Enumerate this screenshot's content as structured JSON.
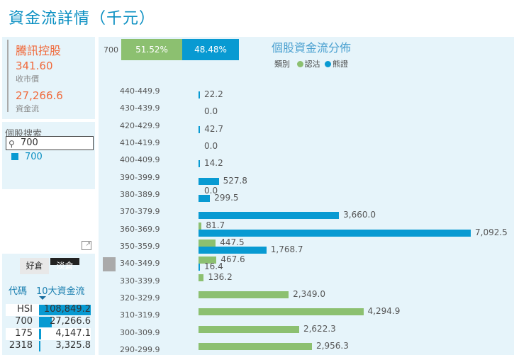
{
  "page": {
    "title": "資金流詳情（千元）"
  },
  "stock_card": {
    "name": "騰訊控股",
    "price": "341.60",
    "price_label": "收市價",
    "flow": "27,266.6",
    "flow_label": "資金流"
  },
  "search": {
    "label": "個股搜索",
    "value": "700",
    "result": "700"
  },
  "top10": {
    "tabs": [
      "好倉",
      "淡倉"
    ],
    "col_code": "代碼",
    "col_flow": "10大資金流",
    "rows": [
      {
        "code": "HSI",
        "value": "108,849.2",
        "ratio": 1.0
      },
      {
        "code": "700",
        "value": "27,266.6",
        "ratio": 0.25
      },
      {
        "code": "175",
        "value": "4,147.1",
        "ratio": 0.04
      },
      {
        "code": "2318",
        "value": "3,325.8",
        "ratio": 0.03
      }
    ]
  },
  "colors": {
    "green": "#8cc070",
    "blue": "#089ad2"
  },
  "split": {
    "label": "700",
    "green_pct": "51.52%",
    "blue_pct": "48.48%",
    "green_frac": 0.5152
  },
  "chart_data": {
    "type": "bar",
    "orientation": "horizontal",
    "title": "個股資金流分佈",
    "legend_title": "類別",
    "series_names": [
      "認沽",
      "熊證"
    ],
    "categories": [
      "440-449.9",
      "430-439.9",
      "420-429.9",
      "410-419.9",
      "400-409.9",
      "390-399.9",
      "380-389.9",
      "370-379.9",
      "360-369.9",
      "350-359.9",
      "340-349.9",
      "330-339.9",
      "320-329.9",
      "310-319.9",
      "300-309.9",
      "290-299.9"
    ],
    "green": [
      null,
      null,
      null,
      null,
      null,
      null,
      0.0,
      null,
      81.7,
      447.5,
      467.6,
      136.2,
      2349.0,
      4294.9,
      2622.3,
      2956.3
    ],
    "blue": [
      22.2,
      0.0,
      42.7,
      0.0,
      14.2,
      527.8,
      299.5,
      3660.0,
      7092.5,
      1768.7,
      16.4,
      null,
      null,
      null,
      null,
      null
    ],
    "green_labels": [
      "",
      "",
      "",
      "",
      "",
      "",
      "0.0",
      "",
      "81.7",
      "447.5",
      "467.6",
      "136.2",
      "2,349.0",
      "4,294.9",
      "2,622.3",
      "2,956.3"
    ],
    "blue_labels": [
      "22.2",
      "0.0",
      "42.7",
      "0.0",
      "14.2",
      "527.8",
      "299.5",
      "3,660.0",
      "7,092.5",
      "1,768.7",
      "16.4",
      "",
      "",
      "",
      "",
      ""
    ],
    "xmax": 7092.5
  }
}
